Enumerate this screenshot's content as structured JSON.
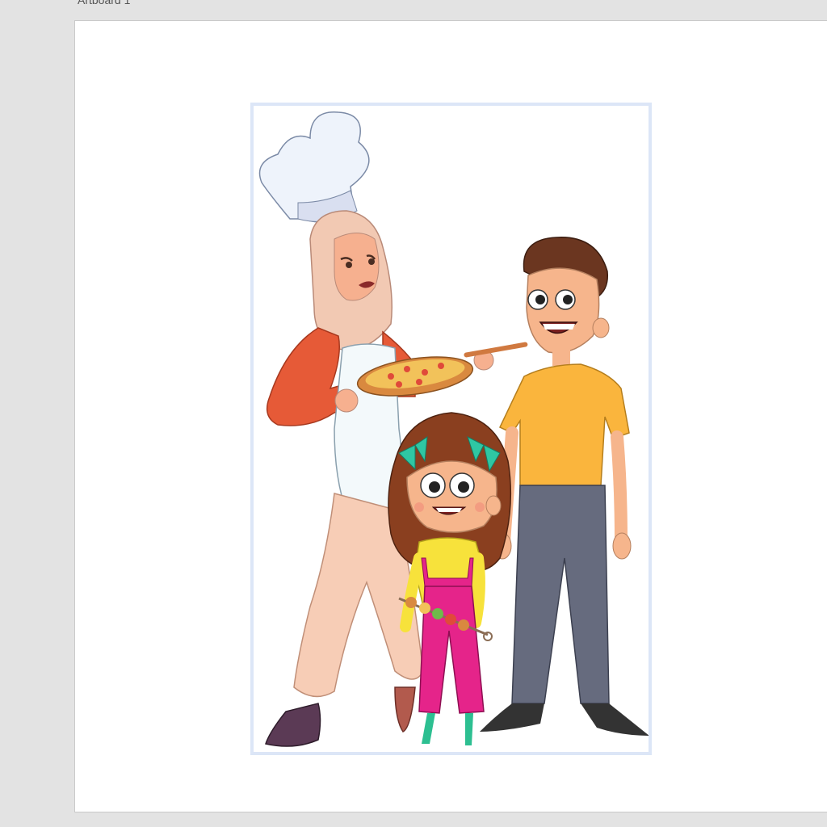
{
  "canvas": {
    "artboard_label": "Artboard 1"
  },
  "selection": {
    "frame_color": "#dce6f7"
  },
  "illustration": {
    "characters": [
      {
        "role": "chef",
        "hijab_color": "#f2c9b3",
        "top_color": "#e65a37",
        "pants_color": "#f7cdb6",
        "shoe_color": "#5b3a55"
      },
      {
        "role": "boy",
        "shirt_color": "#fab53d",
        "pants_color": "#666b7e",
        "hair_color": "#6b3620",
        "shoe_color": "#333333"
      },
      {
        "role": "girl",
        "hair_color": "#8a3f1f",
        "overall_color": "#e5248a",
        "shirt_color": "#f7e23b",
        "bow_color": "#2fc7a3",
        "shoe_color": "#2dbf91"
      }
    ],
    "props": [
      "pizza-peel",
      "skewer"
    ]
  }
}
